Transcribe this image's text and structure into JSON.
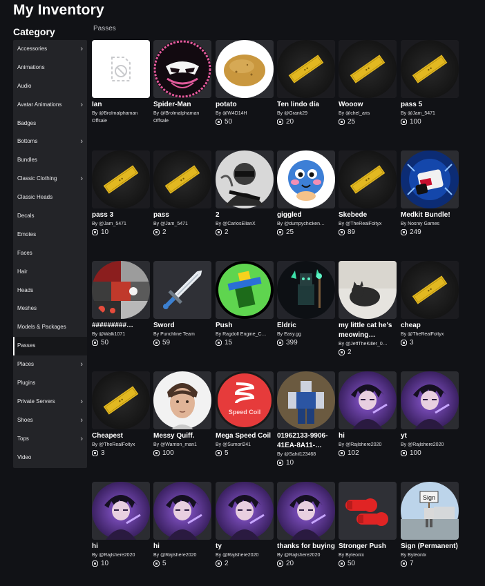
{
  "page": {
    "title": "My Inventory",
    "category_title": "Category",
    "section": "Passes"
  },
  "sidebar": [
    {
      "label": "Accessories",
      "chevron": true
    },
    {
      "label": "Animations",
      "chevron": false
    },
    {
      "label": "Audio",
      "chevron": false
    },
    {
      "label": "Avatar Animations",
      "chevron": true
    },
    {
      "label": "Badges",
      "chevron": false
    },
    {
      "label": "Bottoms",
      "chevron": true
    },
    {
      "label": "Bundles",
      "chevron": false
    },
    {
      "label": "Classic Clothing",
      "chevron": true
    },
    {
      "label": "Classic Heads",
      "chevron": false
    },
    {
      "label": "Decals",
      "chevron": false
    },
    {
      "label": "Emotes",
      "chevron": false
    },
    {
      "label": "Faces",
      "chevron": false
    },
    {
      "label": "Hair",
      "chevron": false
    },
    {
      "label": "Heads",
      "chevron": false
    },
    {
      "label": "Meshes",
      "chevron": false
    },
    {
      "label": "Models & Packages",
      "chevron": false
    },
    {
      "label": "Passes",
      "chevron": false,
      "active": true
    },
    {
      "label": "Places",
      "chevron": true
    },
    {
      "label": "Plugins",
      "chevron": false
    },
    {
      "label": "Private Servers",
      "chevron": true
    },
    {
      "label": "Shoes",
      "chevron": true
    },
    {
      "label": "Tops",
      "chevron": true
    },
    {
      "label": "Video",
      "chevron": false
    }
  ],
  "items": [
    {
      "name": "Ian",
      "by": "By @Brolmalphaman",
      "price": null,
      "offsale": "Offsale",
      "thumb": "placeholder"
    },
    {
      "name": "Spider-Man",
      "by": "By @Brolmalphaman",
      "price": null,
      "offsale": "Offsale",
      "thumb": "spider"
    },
    {
      "name": "potato",
      "by": "By @W4D14H",
      "price": "50",
      "thumb": "potato"
    },
    {
      "name": "Ten lindo día",
      "by": "By @Grank29",
      "price": "20",
      "thumb": "ticket"
    },
    {
      "name": "Wooow",
      "by": "By @chel_aris",
      "price": "25",
      "thumb": "ticket"
    },
    {
      "name": "pass 5",
      "by": "By @Jam_5471",
      "price": "100",
      "thumb": "ticket"
    },
    {
      "name": "pass 3",
      "by": "By @Jam_5471",
      "price": "10",
      "thumb": "ticket"
    },
    {
      "name": "pass",
      "by": "By @Jam_5471",
      "price": "2",
      "thumb": "ticket"
    },
    {
      "name": "2",
      "by": "By @CarlosEllanX",
      "price": "2",
      "thumb": "soldier"
    },
    {
      "name": "giggled",
      "by": "By @dumpychicken…",
      "price": "25",
      "thumb": "emoji"
    },
    {
      "name": "Skebede",
      "by": "By @TheRealFoltyx",
      "price": "89",
      "thumb": "ticket"
    },
    {
      "name": "Medkit Bundle!",
      "by": "By Nosniy Games",
      "price": "249",
      "thumb": "medkit"
    },
    {
      "name": "#########…",
      "by": "By @Walk1071",
      "price": "50",
      "thumb": "collage"
    },
    {
      "name": "Sword",
      "by": "By Punchline Team",
      "price": "59",
      "thumb": "sword"
    },
    {
      "name": "Push",
      "by": "By Ragdoll Engine_C…",
      "price": "15",
      "thumb": "push"
    },
    {
      "name": "Eldric",
      "by": "By Easy.gg",
      "price": "399",
      "thumb": "eldric"
    },
    {
      "name": "my little cat he's meowing…",
      "by": "By @JeffTheKiller_0…",
      "price": "2",
      "thumb": "cat"
    },
    {
      "name": "cheap",
      "by": "By @TheRealFoltyx",
      "price": "3",
      "thumb": "ticket"
    },
    {
      "name": "Cheapest",
      "by": "By @TheRealFoltyx",
      "price": "3",
      "thumb": "ticket"
    },
    {
      "name": "Messy Quiff.",
      "by": "By @Warrion_man1",
      "price": "100",
      "thumb": "face"
    },
    {
      "name": "Mega Speed Coil",
      "by": "By @Sumorl241",
      "price": "5",
      "thumb": "coil"
    },
    {
      "name": "01962133-9906-41EA-8A11-…",
      "by": "By @Sahil123468",
      "price": "10",
      "thumb": "robloxian"
    },
    {
      "name": "hi",
      "by": "By @Rajlshere2020",
      "price": "102",
      "thumb": "anime"
    },
    {
      "name": "yt",
      "by": "By @Rajlshere2020",
      "price": "100",
      "thumb": "anime"
    },
    {
      "name": "hi",
      "by": "By @Rajlshere2020",
      "price": "10",
      "thumb": "anime"
    },
    {
      "name": "hi",
      "by": "By @Rajlshere2020",
      "price": "5",
      "thumb": "anime"
    },
    {
      "name": "ty",
      "by": "By @Rajlshere2020",
      "price": "2",
      "thumb": "anime"
    },
    {
      "name": "thanks for buying",
      "by": "By @Rajlshere2020",
      "price": "20",
      "thumb": "anime"
    },
    {
      "name": "Stronger Push",
      "by": "By Byteonlx",
      "price": "50",
      "thumb": "gloves"
    },
    {
      "name": "Sign (Permanent)",
      "by": "By Byteonlx",
      "price": "7",
      "thumb": "sign"
    }
  ],
  "sign_text": "Sign",
  "coil_text": "Speed Coil"
}
